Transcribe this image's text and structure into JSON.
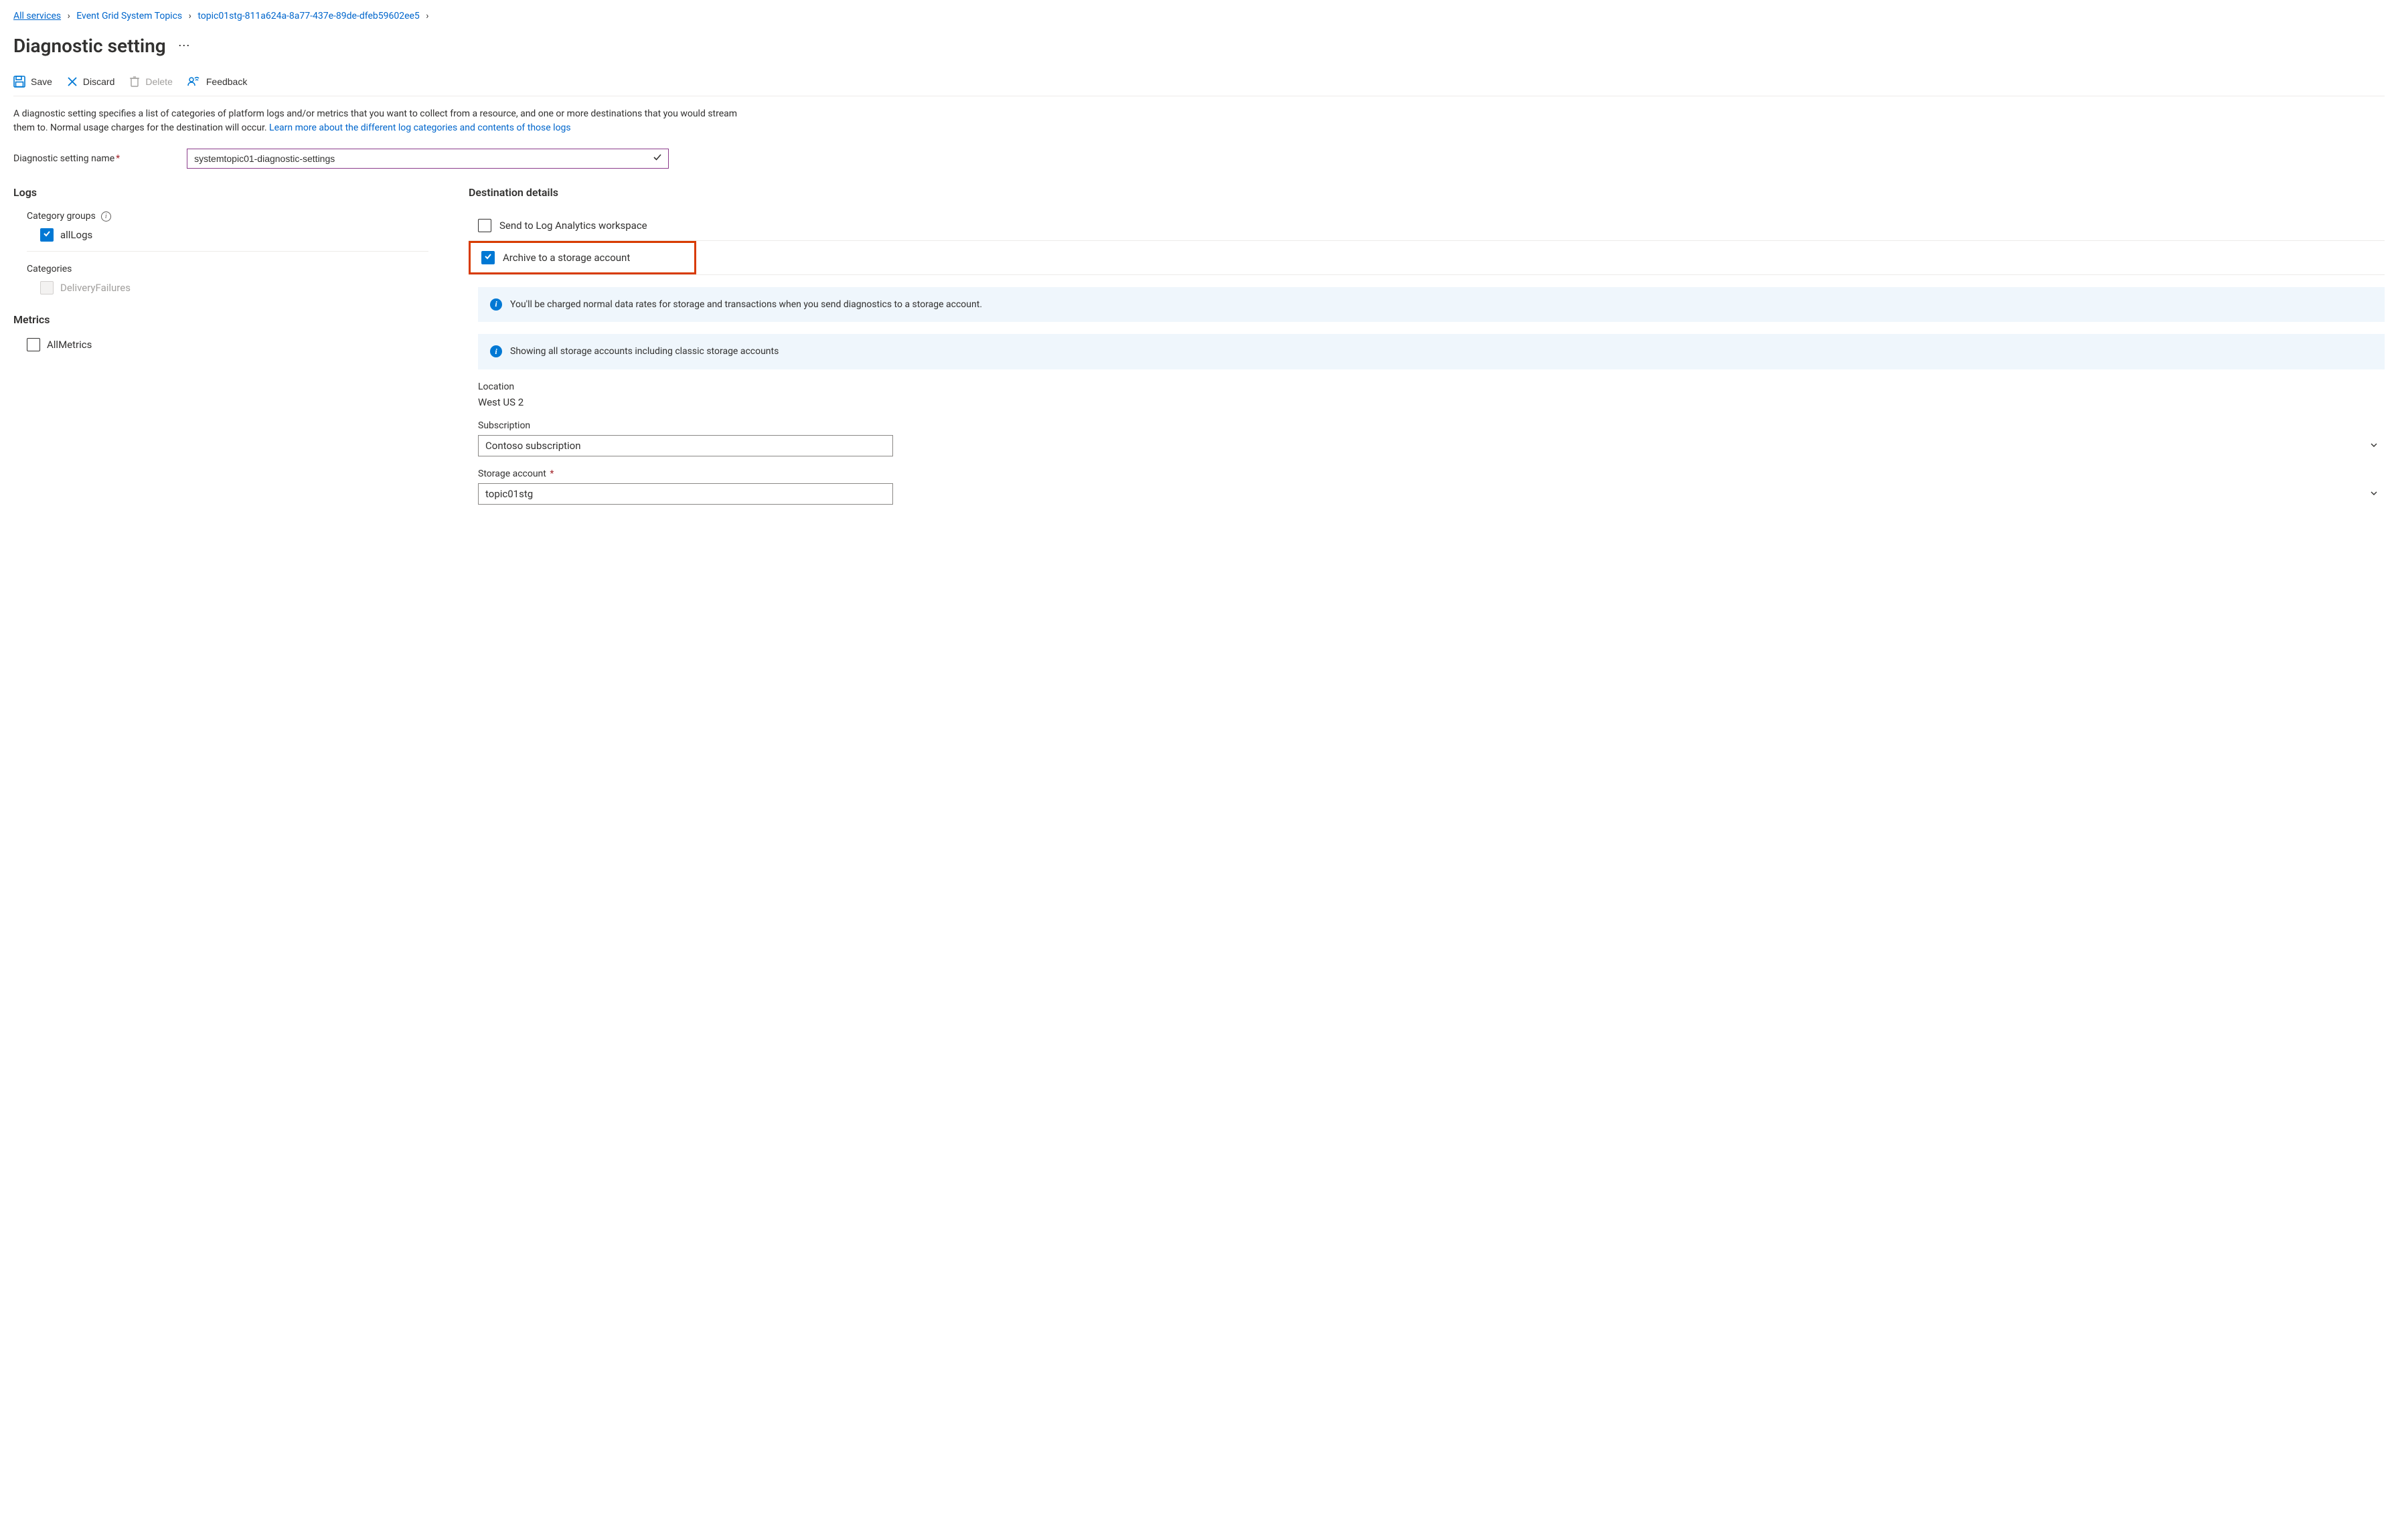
{
  "breadcrumb": {
    "items": [
      "All services",
      "Event Grid System Topics",
      "topic01stg-811a624a-8a77-437e-89de-dfeb59602ee5"
    ]
  },
  "page": {
    "title": "Diagnostic setting"
  },
  "toolbar": {
    "save": "Save",
    "discard": "Discard",
    "delete": "Delete",
    "feedback": "Feedback"
  },
  "description": {
    "text_before_link": "A diagnostic setting specifies a list of categories of platform logs and/or metrics that you want to collect from a resource, and one or more destinations that you would stream them to. Normal usage charges for the destination will occur. ",
    "link": "Learn more about the different log categories and contents of those logs"
  },
  "name_field": {
    "label": "Diagnostic setting name",
    "value": "systemtopic01-diagnostic-settings"
  },
  "logs": {
    "heading": "Logs",
    "category_groups_label": "Category groups",
    "allLogs_label": "allLogs",
    "categories_label": "Categories",
    "deliveryFailures_label": "DeliveryFailures"
  },
  "metrics": {
    "heading": "Metrics",
    "allMetrics_label": "AllMetrics"
  },
  "destinations": {
    "heading": "Destination details",
    "log_analytics_label": "Send to Log Analytics workspace",
    "archive_label": "Archive to a storage account",
    "info1": "You'll be charged normal data rates for storage and transactions when you send diagnostics to a storage account.",
    "info2": "Showing all storage accounts including classic storage accounts",
    "location_label": "Location",
    "location_value": "West US 2",
    "subscription_label": "Subscription",
    "subscription_value": "Contoso subscription",
    "storage_label": "Storage account",
    "storage_value": "topic01stg"
  }
}
